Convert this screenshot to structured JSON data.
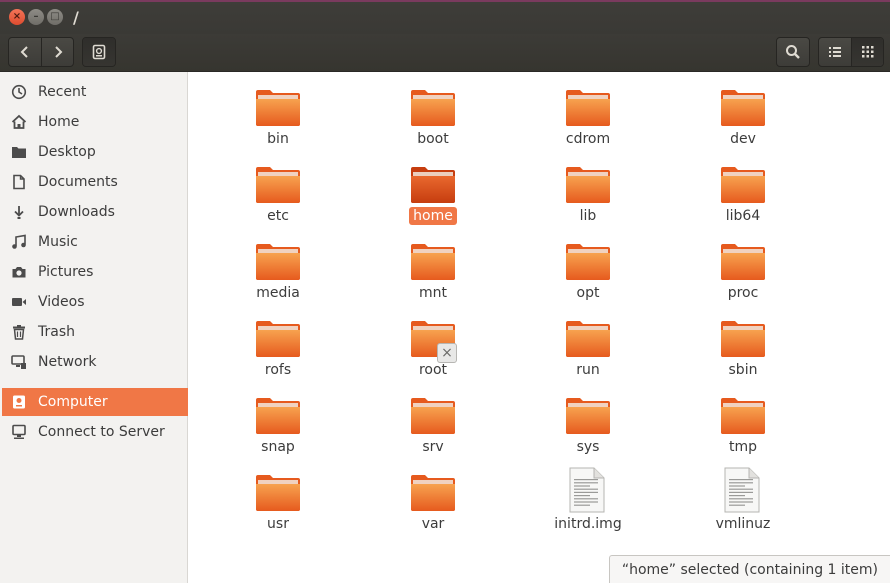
{
  "window": {
    "title": "/",
    "close_glyph": "×",
    "minimize_glyph": "–",
    "maximize_glyph": "□"
  },
  "toolbar": {
    "back_icon": "chevron-left-icon",
    "forward_icon": "chevron-right-icon",
    "location_icon": "drive-icon",
    "search_icon": "search-icon",
    "list_view_icon": "list-view-icon",
    "grid_view_icon": "grid-view-icon",
    "active_view": "grid"
  },
  "sidebar": {
    "items": [
      {
        "label": "Recent",
        "icon": "clock-icon"
      },
      {
        "label": "Home",
        "icon": "home-icon"
      },
      {
        "label": "Desktop",
        "icon": "folder-icon"
      },
      {
        "label": "Documents",
        "icon": "document-icon"
      },
      {
        "label": "Downloads",
        "icon": "download-icon"
      },
      {
        "label": "Music",
        "icon": "music-icon"
      },
      {
        "label": "Pictures",
        "icon": "camera-icon"
      },
      {
        "label": "Videos",
        "icon": "video-icon"
      },
      {
        "label": "Trash",
        "icon": "trash-icon"
      },
      {
        "label": "Network",
        "icon": "network-icon"
      },
      {
        "label": "Computer",
        "icon": "computer-icon",
        "selected": true
      },
      {
        "label": "Connect to Server",
        "icon": "server-icon"
      }
    ]
  },
  "files": [
    {
      "name": "bin",
      "type": "folder"
    },
    {
      "name": "boot",
      "type": "folder"
    },
    {
      "name": "cdrom",
      "type": "folder"
    },
    {
      "name": "dev",
      "type": "folder"
    },
    {
      "name": "etc",
      "type": "folder"
    },
    {
      "name": "home",
      "type": "folder",
      "selected": true
    },
    {
      "name": "lib",
      "type": "folder"
    },
    {
      "name": "lib64",
      "type": "folder"
    },
    {
      "name": "media",
      "type": "folder"
    },
    {
      "name": "mnt",
      "type": "folder"
    },
    {
      "name": "opt",
      "type": "folder"
    },
    {
      "name": "proc",
      "type": "folder"
    },
    {
      "name": "rofs",
      "type": "folder"
    },
    {
      "name": "root",
      "type": "folder",
      "emblem": "×"
    },
    {
      "name": "run",
      "type": "folder"
    },
    {
      "name": "sbin",
      "type": "folder"
    },
    {
      "name": "snap",
      "type": "folder"
    },
    {
      "name": "srv",
      "type": "folder"
    },
    {
      "name": "sys",
      "type": "folder"
    },
    {
      "name": "tmp",
      "type": "folder"
    },
    {
      "name": "usr",
      "type": "folder"
    },
    {
      "name": "var",
      "type": "folder"
    },
    {
      "name": "initrd.img",
      "type": "file"
    },
    {
      "name": "vmlinuz",
      "type": "file"
    }
  ],
  "status": {
    "text": "“home” selected  (containing 1 item)"
  },
  "colors": {
    "accent": "#f07746",
    "folder_top": "#f7a24f",
    "folder_bottom": "#e65a1e",
    "titlebar": "#3c3b37",
    "close_button": "#e9573b"
  }
}
